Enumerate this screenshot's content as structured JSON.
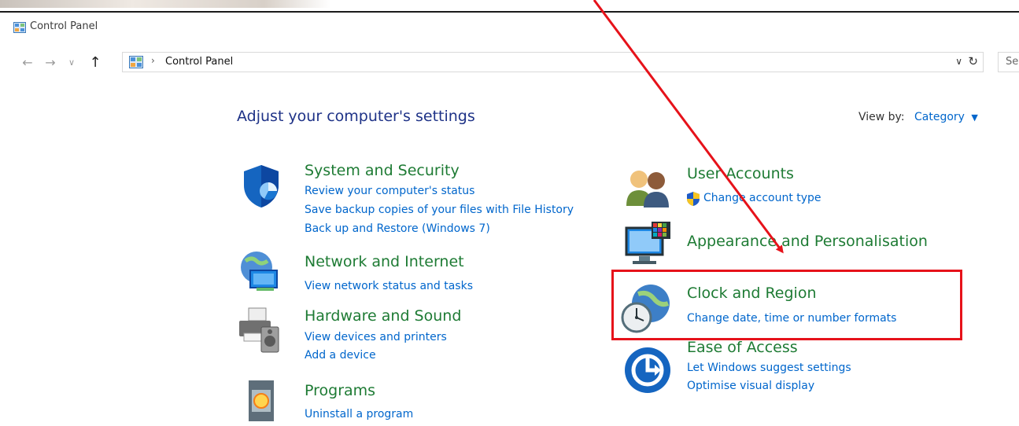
{
  "window": {
    "title": "Control Panel"
  },
  "address": {
    "crumb": "Control Panel",
    "search_placeholder": "Se"
  },
  "main": {
    "heading": "Adjust your computer's settings",
    "view_by_label": "View by:",
    "view_by_value": "Category"
  },
  "categories": {
    "system": {
      "name": "System and Security",
      "links": [
        "Review your computer's status",
        "Save backup copies of your files with File History",
        "Back up and Restore (Windows 7)"
      ]
    },
    "network": {
      "name": "Network and Internet",
      "links": [
        "View network status and tasks"
      ]
    },
    "hardware": {
      "name": "Hardware and Sound",
      "links": [
        "View devices and printers",
        "Add a device"
      ]
    },
    "programs": {
      "name": "Programs",
      "links": [
        "Uninstall a program"
      ]
    },
    "users": {
      "name": "User Accounts",
      "links": [
        "Change account type"
      ]
    },
    "appearance": {
      "name": "Appearance and Personalisation"
    },
    "clock": {
      "name": "Clock and Region",
      "links": [
        "Change date, time or number formats"
      ]
    },
    "ease": {
      "name": "Ease of Access",
      "links": [
        "Let Windows suggest settings",
        "Optimise visual display"
      ]
    }
  },
  "colors": {
    "category_title": "#1e7b34",
    "link": "#0066cc",
    "heading": "#1e3287",
    "annotation": "#e6121a"
  },
  "icons": [
    "control-panel-icon",
    "back-arrow-icon",
    "forward-arrow-icon",
    "recent-dropdown-icon",
    "up-arrow-icon",
    "chevron-down-icon",
    "refresh-icon",
    "shield-icon",
    "network-icon",
    "printer-speaker-icon",
    "programs-icon",
    "users-icon",
    "uac-shield-icon",
    "monitor-palette-icon",
    "globe-clock-icon",
    "ease-of-access-icon"
  ]
}
